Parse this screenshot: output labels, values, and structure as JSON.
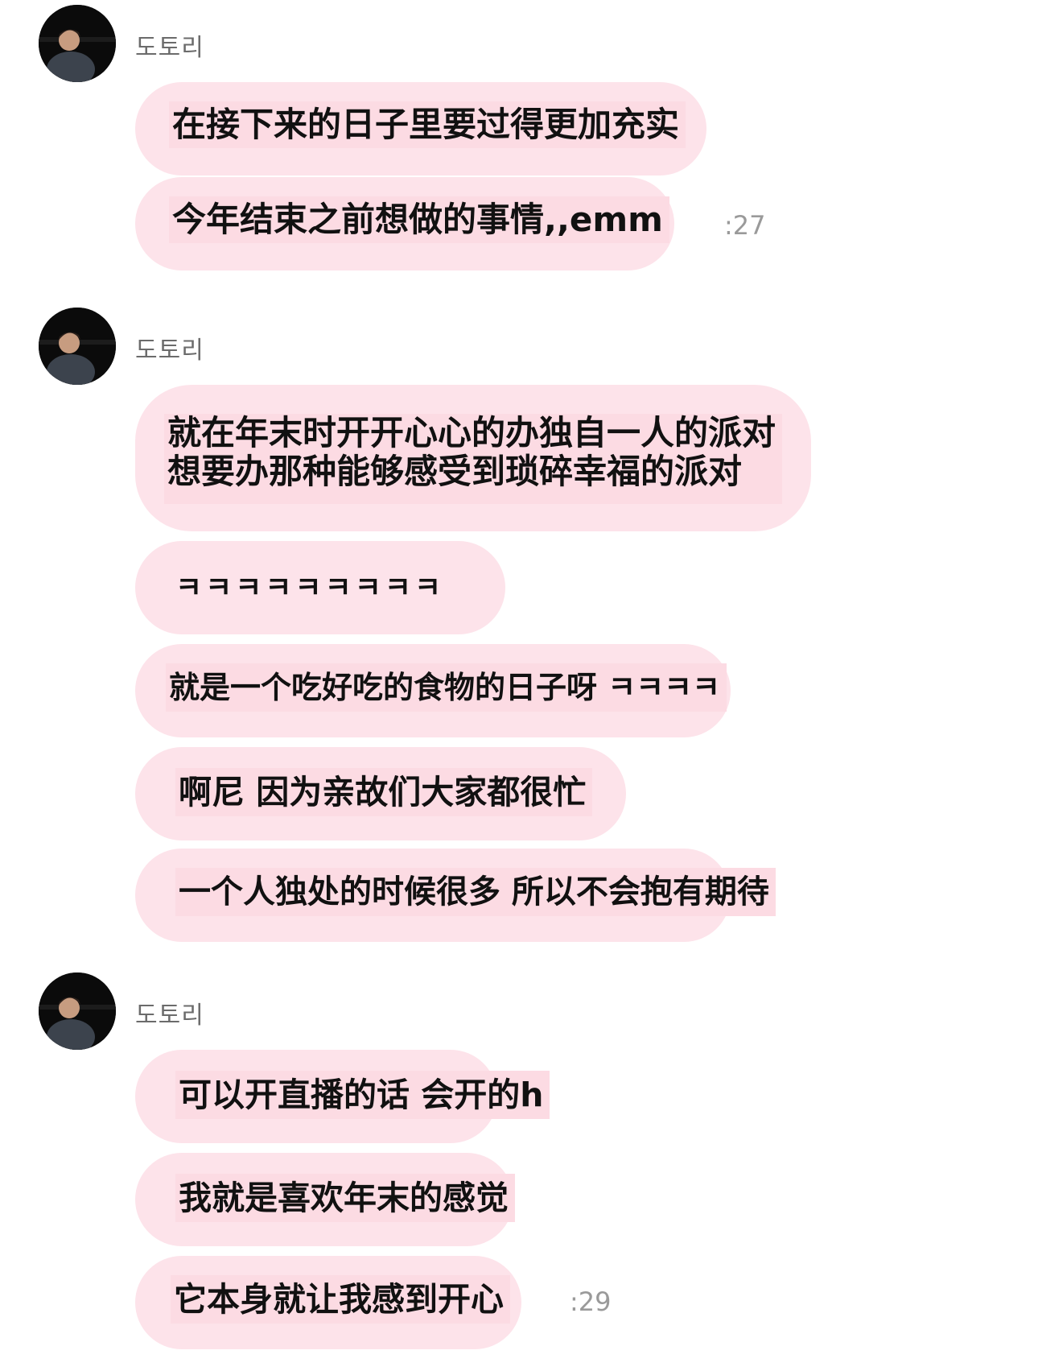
{
  "groups": [
    {
      "sender": "도토리",
      "messages": [
        "在接下来的日子里要过得更加充实",
        "今年结束之前想做的事情,,emm"
      ],
      "time": ":27"
    },
    {
      "sender": "도토리",
      "messages": [
        [
          "就在年末时开开心心的办独自一人的派对",
          "想要办那种能够感受到琐碎幸福的派对"
        ],
        "ㅋㅋㅋㅋㅋㅋㅋㅋㅋ",
        "就是一个吃好吃的食物的日子呀 ㅋㅋㅋㅋ",
        "啊尼 因为亲故们大家都很忙",
        "一个人独处的时候很多 所以不会抱有期待"
      ]
    },
    {
      "sender": "도토리",
      "messages": [
        "可以开直播的话 会开的h",
        "我就是喜欢年末的感觉",
        "它本身就让我感到开心"
      ],
      "time": ":29"
    }
  ]
}
